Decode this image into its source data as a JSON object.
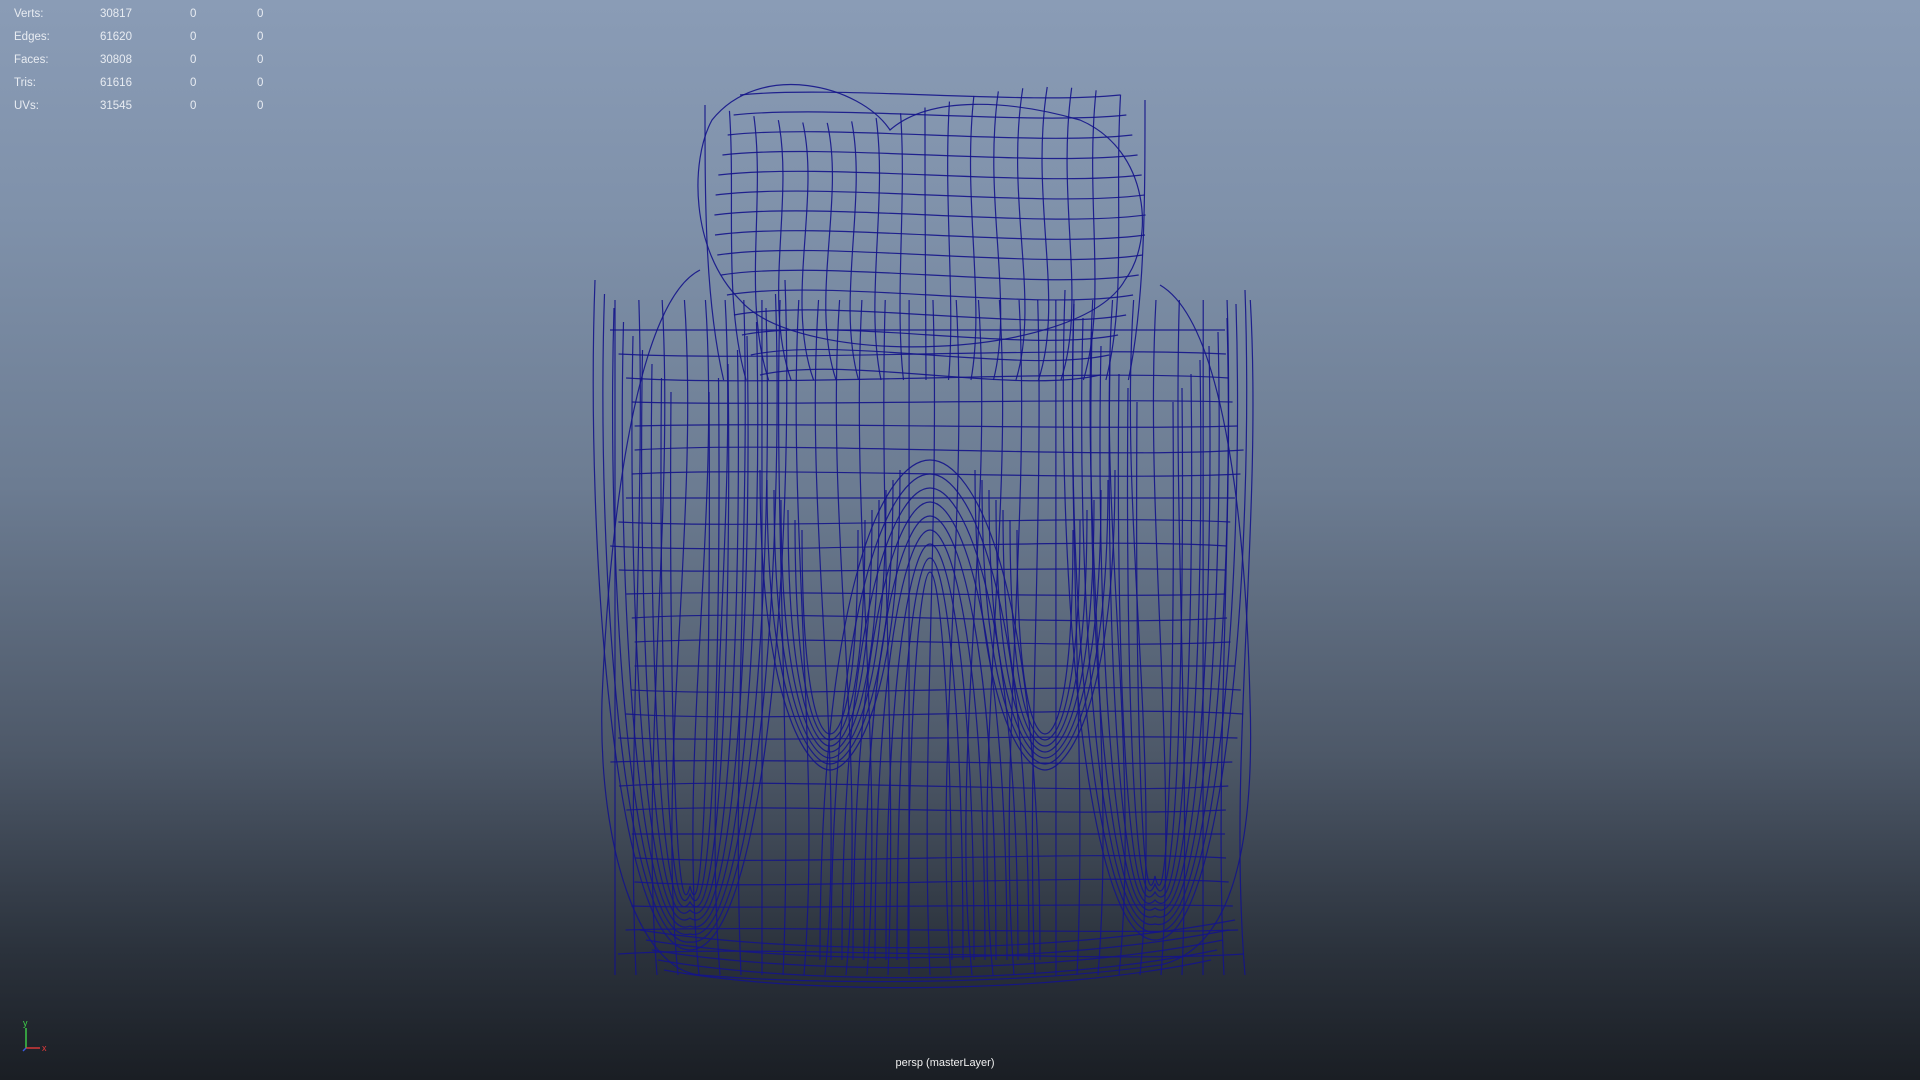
{
  "viewport": {
    "camera_label": "persp (masterLayer)",
    "display_mode": "wireframe",
    "wire_color": "#14148a",
    "background_top": "#8a9cb6",
    "background_bottom": "#1a1e24"
  },
  "hud": {
    "rows": [
      {
        "label": "Verts:",
        "count": "30817",
        "selected": "0",
        "extra": "0"
      },
      {
        "label": "Edges:",
        "count": "61620",
        "selected": "0",
        "extra": "0"
      },
      {
        "label": "Faces:",
        "count": "30808",
        "selected": "0",
        "extra": "0"
      },
      {
        "label": "Tris:",
        "count": "61616",
        "selected": "0",
        "extra": "0"
      },
      {
        "label": "UVs:",
        "count": "31545",
        "selected": "0",
        "extra": "0"
      }
    ]
  },
  "axis_gizmo": {
    "y_label": "y",
    "x_label": "x",
    "y_color": "#3fd24a",
    "x_color": "#e23a3a",
    "z_color": "#3a5ae2"
  }
}
